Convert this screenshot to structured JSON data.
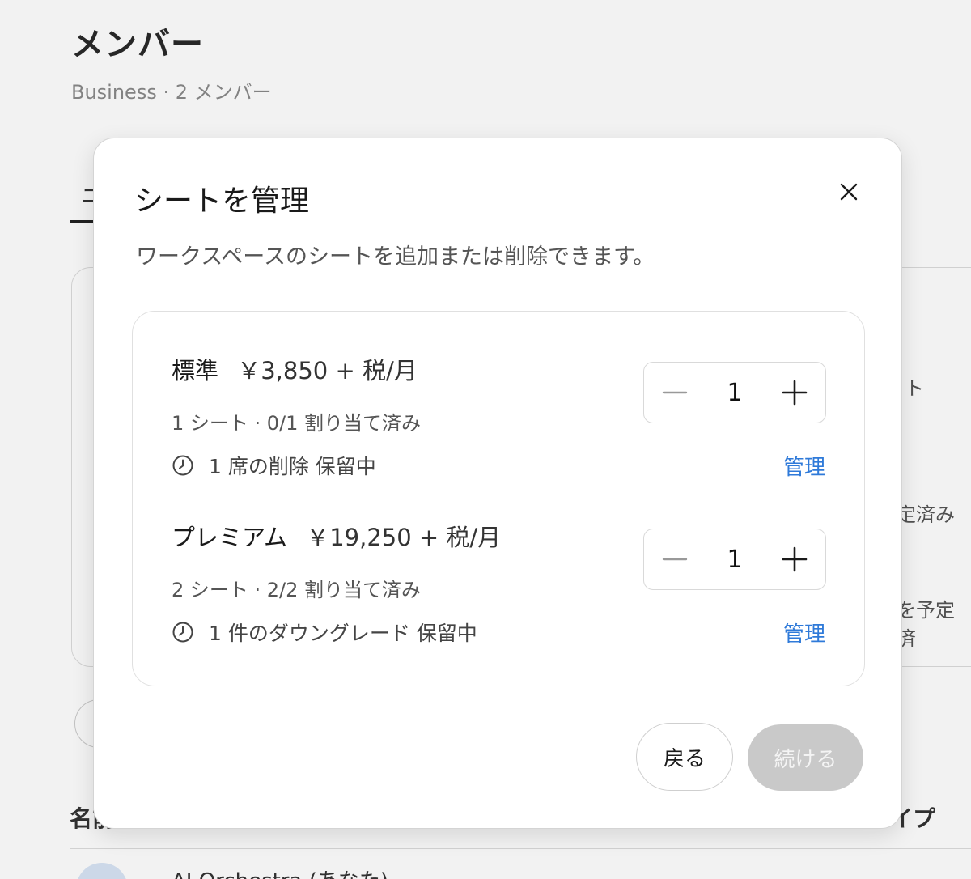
{
  "background": {
    "page_title": "メンバー",
    "page_subtitle": "Business · 2 メンバー",
    "tab_fragment": "ニ",
    "right_fragments": [
      "ト",
      "定済み",
      "を予定済"
    ],
    "column_name_fragment": "名前",
    "column_type_fragment": "イプ",
    "row_name": "AI Orchestra (あなた)"
  },
  "modal": {
    "title": "シートを管理",
    "description": "ワークスペースのシートを追加または削除できます。",
    "close_icon": "close-icon",
    "plans": [
      {
        "name": "標準",
        "price": "￥3,850 + 税/月",
        "seats": "1 シート · 0/1 割り当て済み",
        "pending": "1 席の削除 保留中",
        "manage": "管理",
        "count": "1"
      },
      {
        "name": "プレミアム",
        "price": "￥19,250 + 税/月",
        "seats": "2 シート · 2/2 割り当て済み",
        "pending": "1 件のダウングレード 保留中",
        "manage": "管理",
        "count": "1"
      }
    ],
    "back_label": "戻る",
    "continue_label": "続ける"
  },
  "colors": {
    "accent_link": "#2f7ad9",
    "disabled_button": "#c9c9c9"
  }
}
